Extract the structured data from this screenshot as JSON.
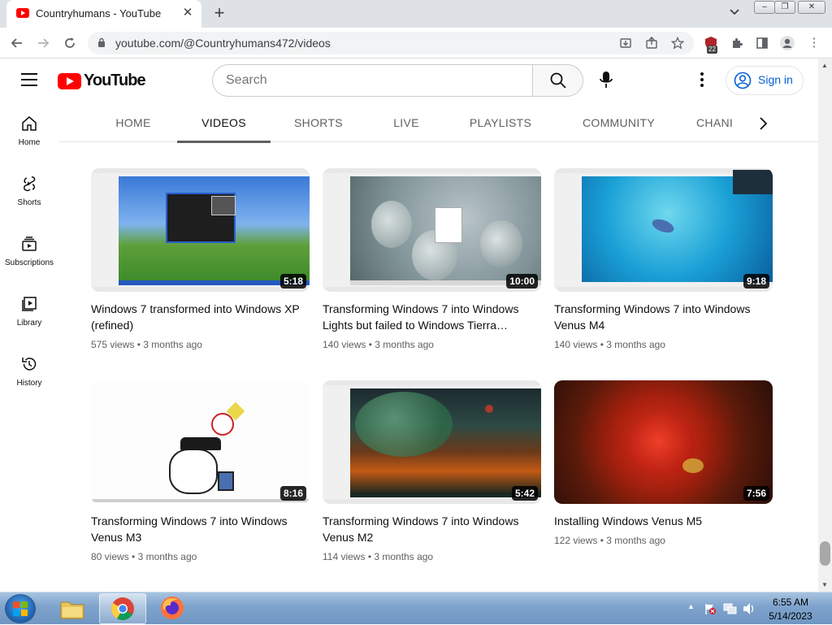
{
  "browser": {
    "tab_title": "Countryhumans - YouTube",
    "url": "youtube.com/@Countryhumans472/videos",
    "extension_badge": "22",
    "colors": {
      "tab_strip": "#dee1e6",
      "toolbar": "#ffffff"
    }
  },
  "youtube": {
    "logo_text": "YouTube",
    "search_placeholder": "Search",
    "sign_in_label": "Sign in",
    "accent_color": "#ff0000",
    "link_color": "#065fd4",
    "guide": [
      {
        "label": "Home",
        "icon": "home-icon"
      },
      {
        "label": "Shorts",
        "icon": "shorts-icon"
      },
      {
        "label": "Subscriptions",
        "icon": "subscriptions-icon"
      },
      {
        "label": "Library",
        "icon": "library-icon"
      },
      {
        "label": "History",
        "icon": "history-icon"
      }
    ],
    "channel_tabs": [
      "HOME",
      "VIDEOS",
      "SHORTS",
      "LIVE",
      "PLAYLISTS",
      "COMMUNITY",
      "CHANI"
    ],
    "active_tab": "VIDEOS",
    "videos": [
      {
        "title": "Windows 7 transformed into Windows XP (refined)",
        "duration": "5:18",
        "views": "575 views",
        "age": "3 months ago"
      },
      {
        "title": "Transforming Windows 7 into Windows Lights but failed to Windows Tierra…",
        "duration": "10:00",
        "views": "140 views",
        "age": "3 months ago"
      },
      {
        "title": "Transforming Windows 7 into Windows Venus M4",
        "duration": "9:18",
        "views": "140 views",
        "age": "3 months ago"
      },
      {
        "title": "Transforming Windows 7 into Windows Venus M3",
        "duration": "8:16",
        "views": "80 views",
        "age": "3 months ago"
      },
      {
        "title": "Transforming Windows 7 into Windows Venus M2",
        "duration": "5:42",
        "views": "114 views",
        "age": "3 months ago"
      },
      {
        "title": "Installing Windows Venus M5",
        "duration": "7:56",
        "views": "122 views",
        "age": "3 months ago"
      }
    ]
  },
  "taskbar": {
    "time": "6:55 AM",
    "date": "5/14/2023",
    "apps": [
      "explorer",
      "chrome",
      "firefox"
    ]
  }
}
